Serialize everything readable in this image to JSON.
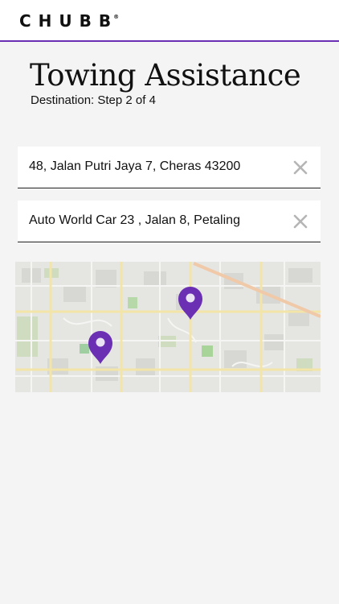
{
  "header": {
    "logo_text": "CHUBB",
    "logo_mark": "®"
  },
  "page": {
    "title": "Towing Assistance",
    "subtitle": "Destination: Step 2 of 4"
  },
  "fields": {
    "pickup": {
      "value": "48, Jalan Putri Jaya 7, Cheras 43200"
    },
    "destination": {
      "value": "Auto World Car 23 , Jalan 8, Petaling"
    }
  },
  "map": {
    "pins": [
      "pickup-pin",
      "destination-pin"
    ]
  },
  "colors": {
    "accent": "#6a2fb3",
    "pin": "#6a2fb3",
    "background": "#f4f4f4"
  }
}
